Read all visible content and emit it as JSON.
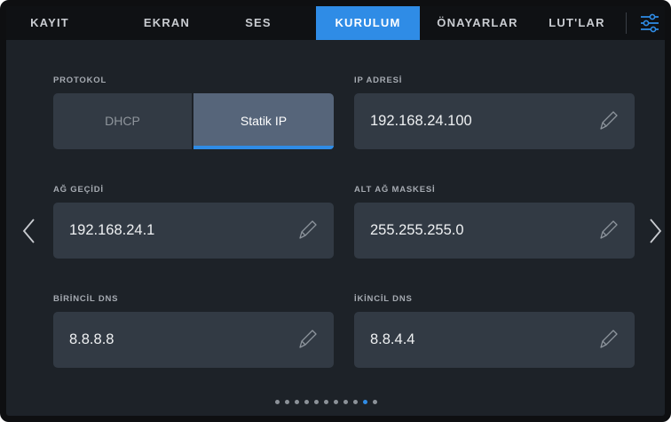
{
  "tabs": [
    {
      "label": "KAYIT",
      "active": false
    },
    {
      "label": "EKRAN",
      "active": false
    },
    {
      "label": "SES",
      "active": false
    },
    {
      "label": "KURULUM",
      "active": true
    },
    {
      "label": "ÖNAYARLAR",
      "active": false
    },
    {
      "label": "LUT'LAR",
      "active": false
    }
  ],
  "settings_icon": "sliders-icon",
  "protocol": {
    "label": "PROTOKOL",
    "options": [
      "DHCP",
      "Statik IP"
    ],
    "selected": "Statik IP"
  },
  "ip_address": {
    "label": "IP ADRESİ",
    "value": "192.168.24.100"
  },
  "gateway": {
    "label": "AĞ GEÇİDİ",
    "value": "192.168.24.1"
  },
  "subnet_mask": {
    "label": "ALT AĞ MASKESİ",
    "value": "255.255.255.0"
  },
  "primary_dns": {
    "label": "BİRİNCİL DNS",
    "value": "8.8.8.8"
  },
  "secondary_dns": {
    "label": "İKİNCİL DNS",
    "value": "8.8.4.4"
  },
  "edit_icon": "pencil-icon",
  "pagination": {
    "total": 11,
    "current": 10
  },
  "colors": {
    "accent": "#2f8ce6",
    "background": "#1d2228",
    "field": "#323a44"
  }
}
